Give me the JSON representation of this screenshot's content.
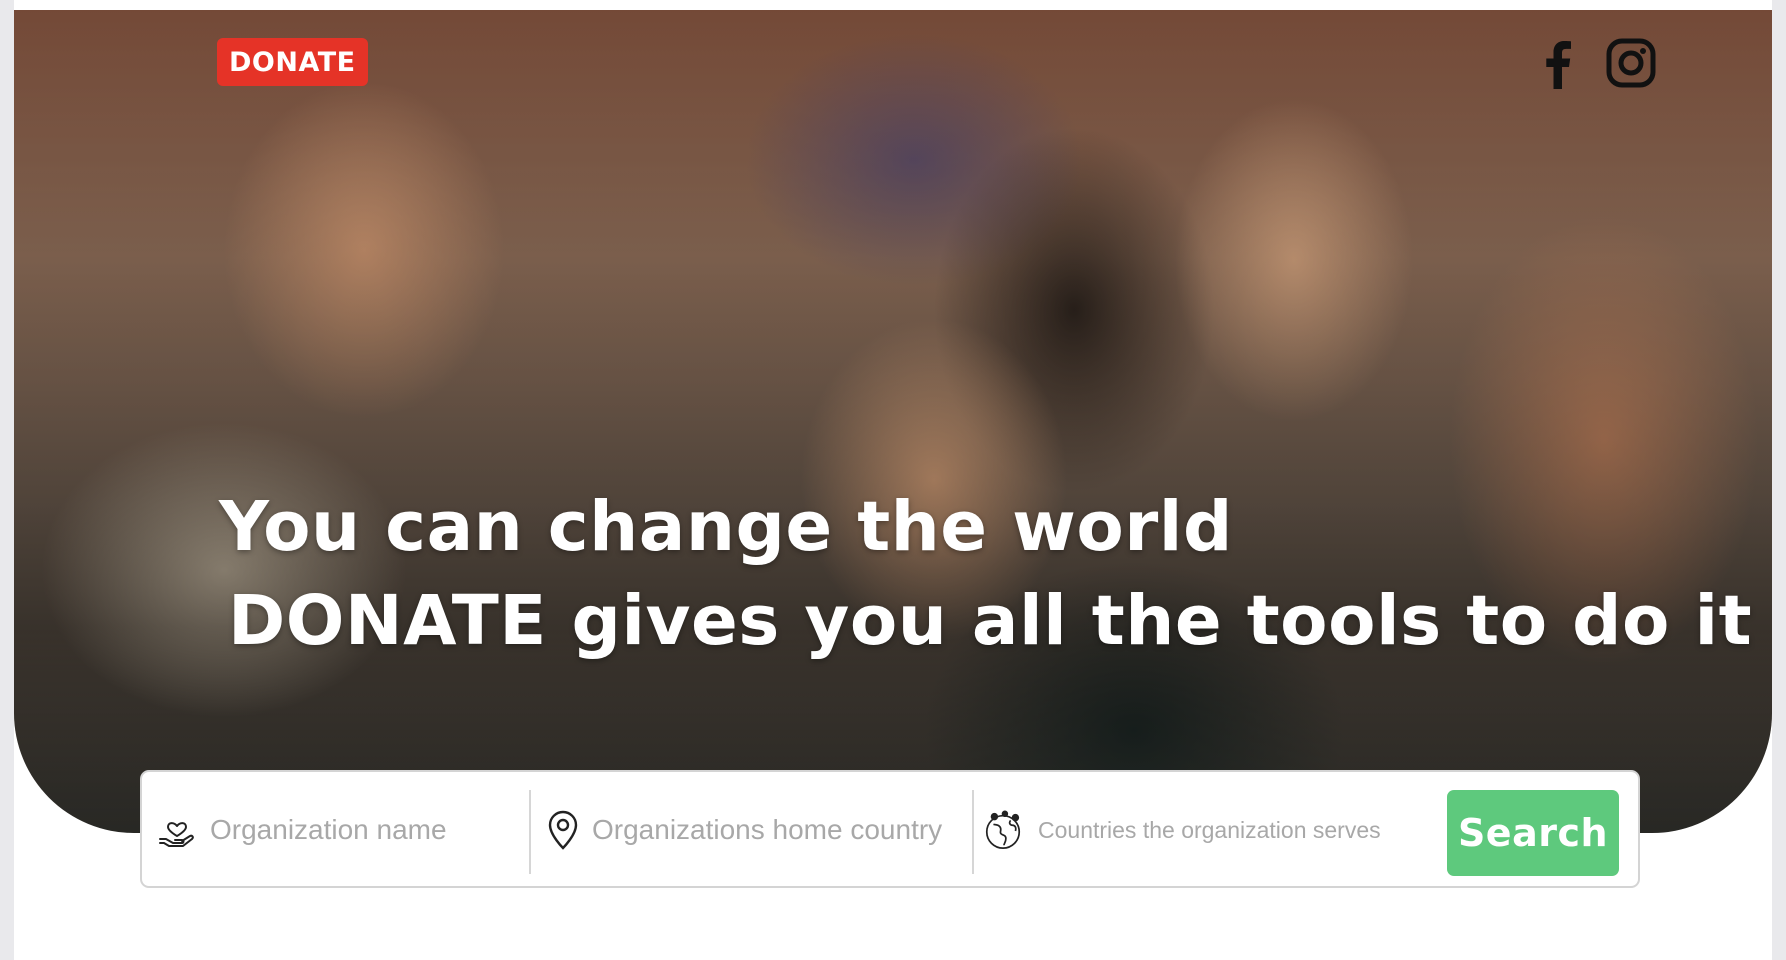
{
  "header": {
    "logo_label": "DONATE",
    "social": [
      {
        "name": "facebook",
        "icon": "facebook-icon"
      },
      {
        "name": "instagram",
        "icon": "instagram-icon"
      }
    ]
  },
  "hero": {
    "headline_line1": "You can change the world",
    "headline_line2": "DONATE gives you all the tools to do it",
    "image": "photo of smiling children reaching toward the camera"
  },
  "search": {
    "organization_name": {
      "placeholder": "Organization name",
      "icon": "hand-heart-icon"
    },
    "home_country": {
      "placeholder": "Organizations home country",
      "icon": "map-pin-icon"
    },
    "countries_served": {
      "placeholder": "Countries the organization serves",
      "icon": "globe-icon"
    },
    "button_label": "Search"
  },
  "colors": {
    "brand_red": "#e53327",
    "search_green": "#5ec97d",
    "placeholder_gray": "#a8a8a8"
  }
}
